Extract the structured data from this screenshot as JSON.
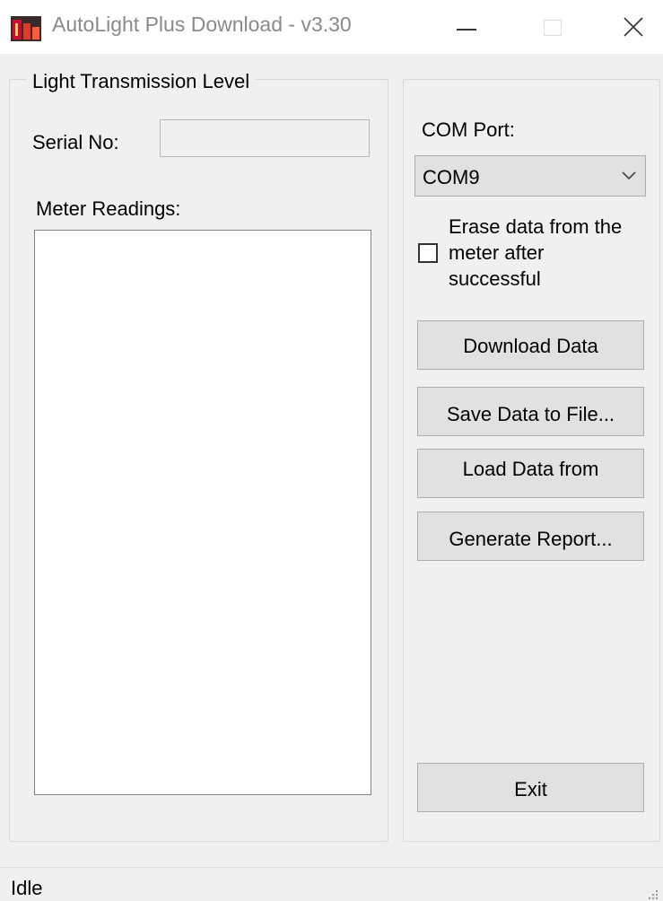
{
  "window": {
    "title": "AutoLight Plus Download - v3.30",
    "icon": "app-icon",
    "controls": [
      "minimize-icon",
      "maximize-icon",
      "close-icon"
    ]
  },
  "left_panel": {
    "group_title": "Light Transmission Level",
    "serial_label": "Serial No:",
    "serial_value": "",
    "readings_label": "Meter Readings:",
    "readings": []
  },
  "right_panel": {
    "com_port_label": "COM Port:",
    "com_port_value": "COM9",
    "erase_checkbox_label": "Erase data from the meter after successful",
    "erase_checked": false,
    "buttons": {
      "download": "Download Data",
      "save": "Save Data to File...",
      "load": "Load Data from",
      "report": "Generate Report...",
      "exit": "Exit"
    }
  },
  "status_bar": {
    "text": "Idle"
  },
  "colors": {
    "window_bg": "#f0f0f0",
    "button_bg": "#e1e1e1",
    "title_text": "#8a8a8a",
    "icon_red": "#c8102e"
  }
}
